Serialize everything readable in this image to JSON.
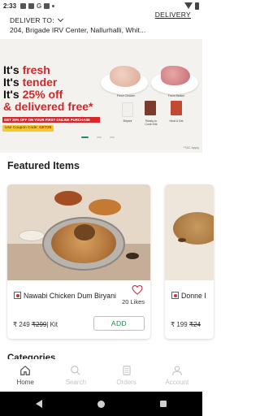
{
  "status_bar": {
    "time": "2:33"
  },
  "delivery": {
    "label": "DELIVER TO:",
    "address": "204, Brigade IRV Center, Nallurhalli, Whit...",
    "action": "DELIVERY"
  },
  "banner": {
    "line1_prefix": "It's ",
    "line1_red": "fresh",
    "line2_prefix": "It's ",
    "line2_red": "tender",
    "line3_prefix": "It's ",
    "line3_red": "25% off",
    "line4": "& delivered free*",
    "strip": "GET 25% OFF ON YOUR FIRST ONLINE PURCHASE",
    "coupon_prefix": "Use Coupon Code: ",
    "coupon_code": "GET25",
    "products": [
      "Fresh Chicken",
      "Fresh Mutton",
      "Biryani",
      "Ready to Cook Kits",
      "Heat & Eat"
    ],
    "tnc": "*T&C Apply",
    "carousel_count": 3,
    "carousel_active": 0
  },
  "featured": {
    "title": "Featured Items",
    "items": [
      {
        "name": "Nawabi Chicken Dum Biryani",
        "likes": "20 Likes",
        "price": "₹ 249",
        "old_price": "₹299",
        "unit": "| Kit",
        "add_label": "ADD"
      },
      {
        "name": "Donne Biryani",
        "price": "₹ 199",
        "old_price": "₹24"
      }
    ]
  },
  "categories_title": "Categories",
  "bottom_nav": {
    "items": [
      {
        "label": "Home",
        "icon": "home-icon",
        "active": true
      },
      {
        "label": "Search",
        "icon": "search-icon",
        "active": false
      },
      {
        "label": "Orders",
        "icon": "orders-icon",
        "active": false
      },
      {
        "label": "Account",
        "icon": "account-icon",
        "active": false
      }
    ]
  },
  "colors": {
    "brand_red": "#d02828",
    "add_green": "#1a8a45",
    "accent_teal": "#1f8a70"
  }
}
